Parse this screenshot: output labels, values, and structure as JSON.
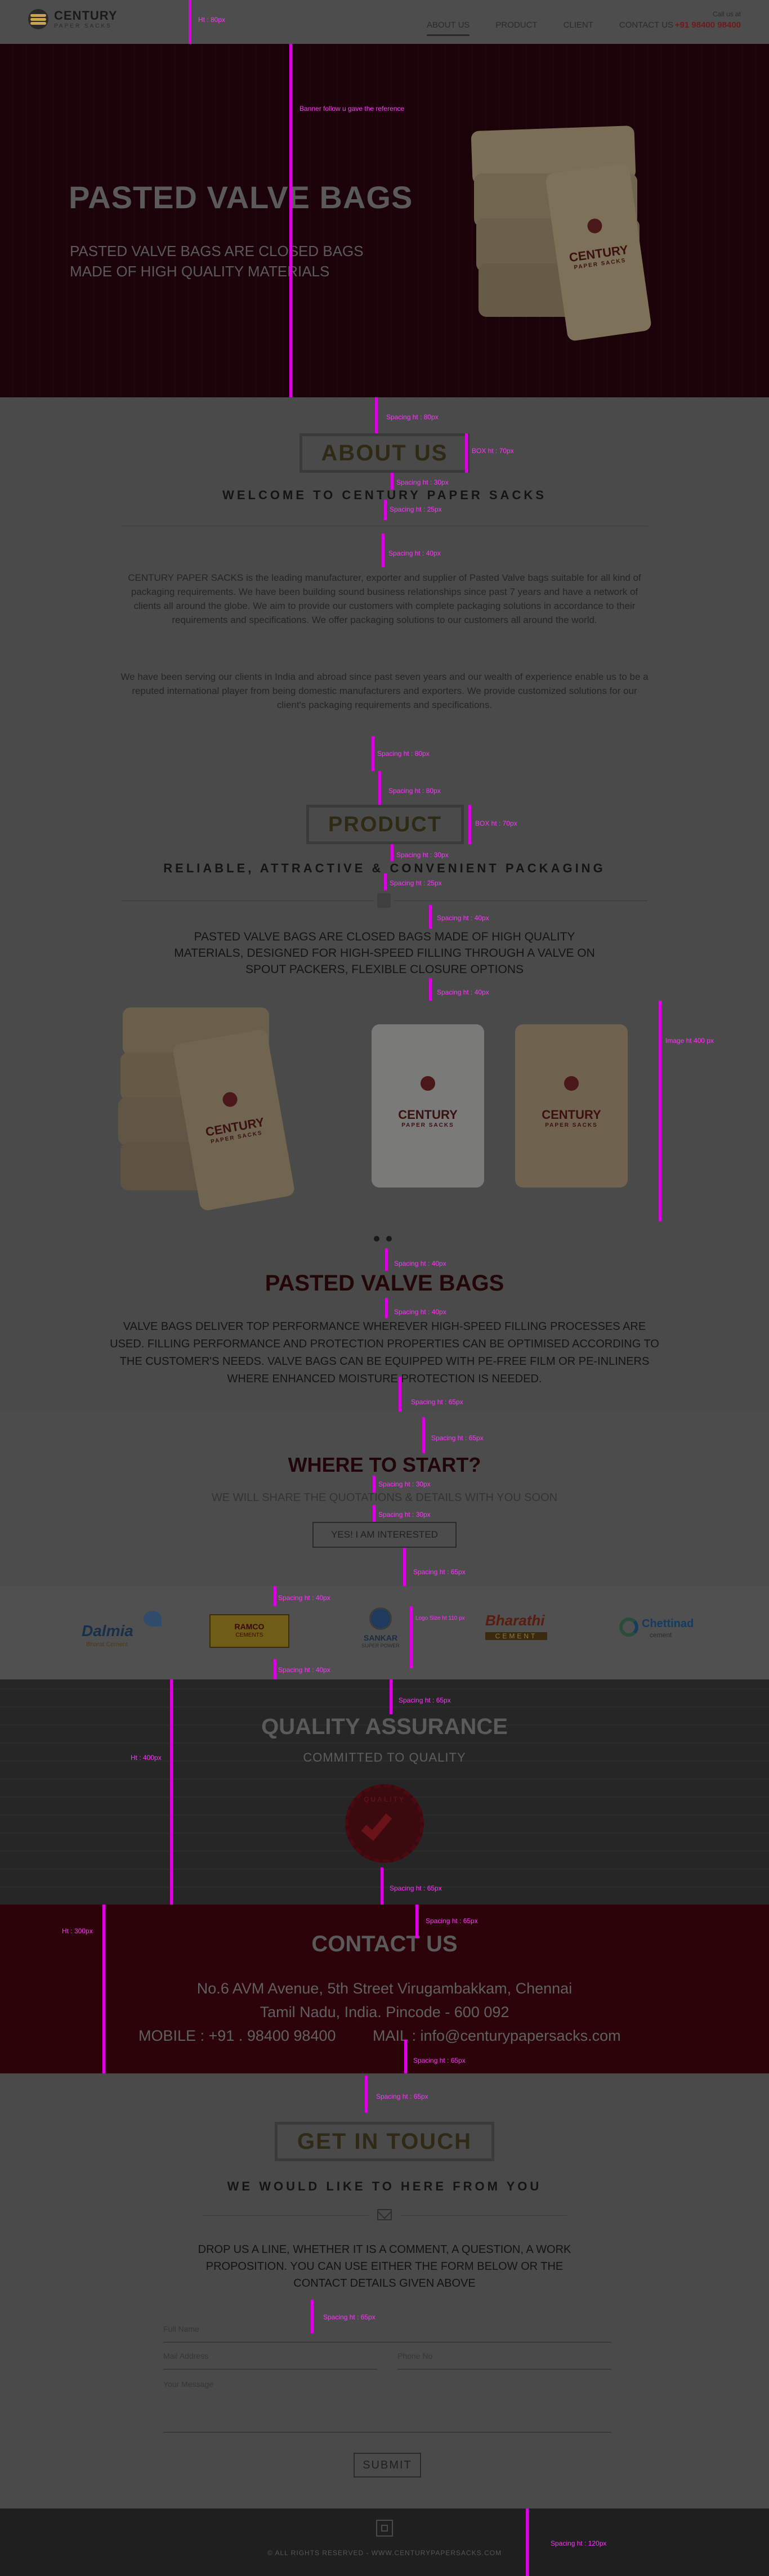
{
  "header": {
    "logo_name": "CENTURY",
    "logo_sub": "PAPER SACKS",
    "nav": [
      "ABOUT US",
      "PRODUCT",
      "CLIENT",
      "CONTACT US"
    ],
    "call_label": "Call us at",
    "call_number": "+91 98400 98400"
  },
  "hero": {
    "title": "PASTED VALVE BAGS",
    "subtitle": "PASTED VALVE BAGS ARE CLOSED BAGS MADE OF HIGH QUALITY MATERIALS",
    "bag_brand": "CENTURY",
    "bag_sub": "PAPER SACKS"
  },
  "about": {
    "title": "ABOUT US",
    "subtitle": "WELCOME TO CENTURY PAPER SACKS",
    "para1": "CENTURY PAPER SACKS is the leading manufacturer, exporter and supplier of Pasted Valve bags suitable for all kind of packaging requirements. We have been building sound business relationships since past 7 years and have a network of clients all around the globe. We aim to provide our customers with complete packaging solutions in accordance to their requirements and specifications. We offer packaging solutions to our customers all around the world.",
    "para2": "We have been serving our clients in India and abroad since past seven years and our wealth of experience enable us to be a reputed international player from being domestic manufacturers and exporters. We provide customized solutions for our client's packaging requirements and specifications."
  },
  "product": {
    "title": "PRODUCT",
    "subtitle": "RELIABLE, ATTRACTIVE & CONVENIENT PACKAGING",
    "description": "PASTED VALVE BAGS ARE CLOSED BAGS MADE OF HIGH QUALITY MATERIALS, DESIGNED FOR HIGH-SPEED FILLING THROUGH A VALVE ON SPOUT PACKERS, FLEXIBLE CLOSURE OPTIONS",
    "item_title": "PASTED VALVE BAGS",
    "item_desc": "VALVE BAGS DELIVER TOP PERFORMANCE WHEREVER HIGH-SPEED FILLING PROCESSES ARE USED. FILLING PERFORMANCE AND PROTECTION PROPERTIES CAN BE OPTIMISED ACCORDING TO THE CUSTOMER'S NEEDS. VALVE BAGS CAN BE EQUIPPED WITH PE-FREE FILM OR PE-INLINERS WHERE ENHANCED MOISTURE PROTECTION IS NEEDED.",
    "bag_brand": "CENTURY",
    "bag_sub": "PAPER SACKS"
  },
  "cta": {
    "title": "WHERE TO START?",
    "subtitle": "WE WILL SHARE THE QUOTATIONS & DETAILS WITH YOU SOON",
    "button": "YES! I AM INTERESTED"
  },
  "clients": {
    "dalmia": "Dalmia",
    "dalmia_sub": "Bharat Cement",
    "ramco": "RAMCO",
    "ramco_sub": "CEMENTS",
    "sankar": "SANKAR",
    "sankar_sub": "SUPER POWER",
    "bharathi": "Bharathi",
    "bharathi_sub": "CEMENT",
    "chettinad": "Chettinad",
    "chettinad_sub": "cement"
  },
  "qa": {
    "title": "QUALITY ASSURANCE",
    "subtitle": "COMMITTED TO QUALITY",
    "seal_text": "QUALITY"
  },
  "contact": {
    "title": "CONTACT US",
    "address1": "No.6 AVM Avenue, 5th Street Virugambakkam, Chennai",
    "address2": "Tamil Nadu, India. Pincode -  600 092",
    "mobile": "MOBILE : +91 . 98400 98400",
    "mail": "MAIL : info@centurypapersacks.com"
  },
  "touch": {
    "title": "GET IN TOUCH",
    "subtitle": "WE WOULD LIKE TO HERE FROM YOU",
    "text": "DROP US A LINE, WHETHER IT IS A COMMENT, A QUESTION, A WORK PROPOSITION. YOU CAN USE EITHER THE FORM BELOW OR THE CONTACT DETAILS GIVEN ABOVE",
    "name_ph": "Full Name",
    "email_ph": "Mail Address",
    "phone_ph": "Phone No",
    "message_ph": "Your Message",
    "submit": "SUBMIT"
  },
  "footer": {
    "copyright": "© ALL RIGHTS RESERVED - WWW.CENTURYPAPERSACKS.COM"
  },
  "guides": {
    "header_ht": "Ht : 80px",
    "banner_note": "Banner follow u gave the reference",
    "sp80": "Spacing ht : 80px",
    "sp30": "Spacing ht : 30px",
    "sp25": "Spacing ht : 25px",
    "sp40": "Spacing ht : 40px",
    "sp65": "Spacing ht : 65px",
    "sp120": "Spacing ht : 120px",
    "box_ht": "BOX ht : 70px",
    "image_ht": "Image ht 400 px",
    "logo_size": "Logo Size ht 110 px",
    "ht400": "Ht : 400px",
    "ht300": "Ht : 300px"
  },
  "colors": {
    "hero_bg": "#1c0309",
    "contact_bg": "#2b0308",
    "guide": "#e000e6",
    "gold": "#c9a64a"
  }
}
